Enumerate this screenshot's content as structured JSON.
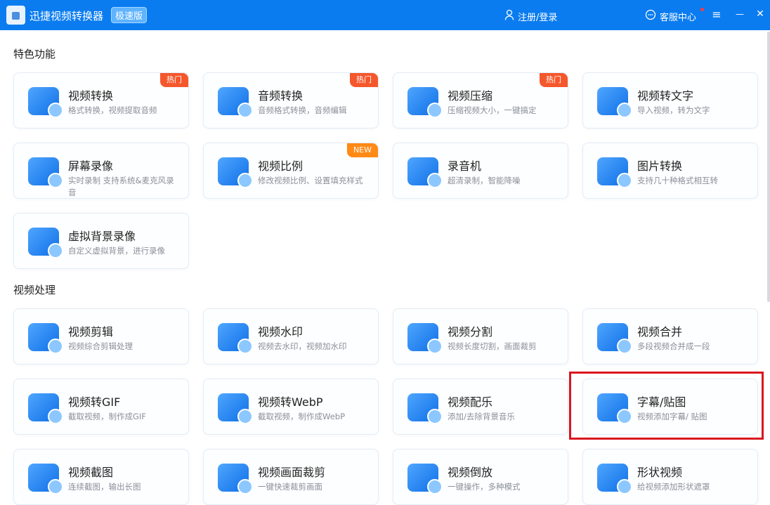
{
  "titlebar": {
    "app_name": "迅捷视频转换器",
    "edition": "极速版",
    "login": "注册/登录",
    "support": "客服中心",
    "menu_icon": "≡",
    "minimize_icon": "—",
    "close_icon": "✕"
  },
  "sections": [
    {
      "title": "特色功能",
      "cards": [
        {
          "title": "视频转换",
          "desc": "格式转换，视频提取音频",
          "badge": "热门"
        },
        {
          "title": "音频转换",
          "desc": "音频格式转换，音频编辑",
          "badge": "热门"
        },
        {
          "title": "视频压缩",
          "desc": "压缩视频大小，一键搞定",
          "badge": "热门"
        },
        {
          "title": "视频转文字",
          "desc": "导入视频，转为文字"
        },
        {
          "title": "屏幕录像",
          "desc": "实时录制 支持系统&麦克风录音"
        },
        {
          "title": "视频比例",
          "desc": "修改视频比例、设置填充样式",
          "badge": "NEW"
        },
        {
          "title": "录音机",
          "desc": "超清录制，智能降噪"
        },
        {
          "title": "图片转换",
          "desc": "支持几十种格式相互转"
        },
        {
          "title": "虚拟背景录像",
          "desc": "自定义虚拟背景，进行录像"
        }
      ]
    },
    {
      "title": "视频处理",
      "cards": [
        {
          "title": "视频剪辑",
          "desc": "视频综合剪辑处理"
        },
        {
          "title": "视频水印",
          "desc": "视频去水印，视频加水印"
        },
        {
          "title": "视频分割",
          "desc": "视频长度切割，画面裁剪"
        },
        {
          "title": "视频合并",
          "desc": "多段视频合并成一段"
        },
        {
          "title": "视频转GIF",
          "desc": "截取视频，制作成GIF"
        },
        {
          "title": "视频转WebP",
          "desc": "截取视频，制作成WebP"
        },
        {
          "title": "视频配乐",
          "desc": "添加/去除背景音乐"
        },
        {
          "title": "字幕/贴图",
          "desc": "视频添加字幕/ 贴图"
        },
        {
          "title": "视频截图",
          "desc": "连续截图，输出长图"
        },
        {
          "title": "视频画面裁剪",
          "desc": "一键快速裁剪画面"
        },
        {
          "title": "视频倒放",
          "desc": "一键操作，多种模式"
        },
        {
          "title": "形状视频",
          "desc": "给视频添加形状遮罩"
        }
      ]
    }
  ],
  "highlight_card": "字幕/贴图"
}
